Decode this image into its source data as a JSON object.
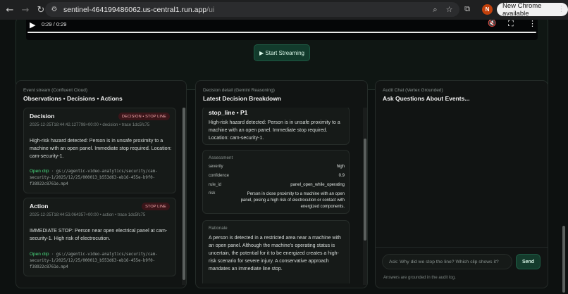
{
  "browser": {
    "url_host": "sentinel-464199486062.us-central1.run.app",
    "url_path": "/ui",
    "profile_initial": "N",
    "update_label": "New Chrome available"
  },
  "video": {
    "time": "0:29 / 0:29",
    "start_label": "▶ Start Streaming"
  },
  "events_panel": {
    "eyebrow": "Event stream (Confluent Cloud)",
    "title": "Observations • Decisions • Actions",
    "cards": [
      {
        "title": "Decision",
        "badge": "DECISION • STOP LINE",
        "meta": "2025-12-25T18:44:42.127798+00:00 • decision • trace 1dc5fc75",
        "body": "High-risk hazard detected: Person is in unsafe proximity to a machine with an open panel. Immediate stop required. Location: cam-security-1.",
        "clip_link": "Open clip",
        "clip_path": "gs://agentic-video-analytics/security/cam-security-1/2025/12/25/000013_b553d63-eb16-455e-b9f0-f38922c8761e.mp4"
      },
      {
        "title": "Action",
        "badge": "STOP LINE",
        "meta": "2025-12-25T18:44:53.064357+00:00 • action • trace 1dc5fc75",
        "body": "IMMEDIATE STOP: Person near open electrical panel at cam-security-1. High risk of electrocution.",
        "clip_link": "Open clip",
        "clip_path": "gs://agentic-video-analytics/security/cam-security-1/2025/12/25/000013_b553d63-eb16-455e-b9f0-f38922c8761e.mp4"
      }
    ]
  },
  "decision_panel": {
    "eyebrow": "Decision detail (Gemini Reasoning)",
    "title": "Latest Decision Breakdown",
    "headline": "stop_line • P1",
    "summary": "High-risk hazard detected: Person is in unsafe proximity to a machine with an open panel. Immediate stop required. Location: cam-security-1.",
    "assessment_label": "Assessment",
    "assessment": [
      {
        "key": "severity",
        "value": "high"
      },
      {
        "key": "confidence",
        "value": "0.9"
      },
      {
        "key": "rule_id",
        "value": "panel_open_while_operating"
      },
      {
        "key": "risk",
        "value": "Person in close proximity to a machine with an open panel, posing a high risk of electrocution or contact with energized components."
      }
    ],
    "rationale_label": "Rationale",
    "rationale": "A person is detected in a restricted area near a machine with an open panel. Although the machine's operating status is uncertain, the potential for it to be energized creates a high-risk scenario for severe injury. A conservative approach mandates an immediate line stop."
  },
  "chat_panel": {
    "eyebrow": "Audit Chat (Vertex Grounded)",
    "title": "Ask Questions About Events...",
    "placeholder": "Ask: Why did we stop the line? Which clip shows it?",
    "send_label": "Send",
    "note": "Answers are grounded in the audit log."
  },
  "colors": {
    "accent_green": "#4ade80",
    "badge_red_bg": "#3a1519",
    "badge_red_text": "#f6a9ae",
    "button_green": "#143b2c"
  }
}
